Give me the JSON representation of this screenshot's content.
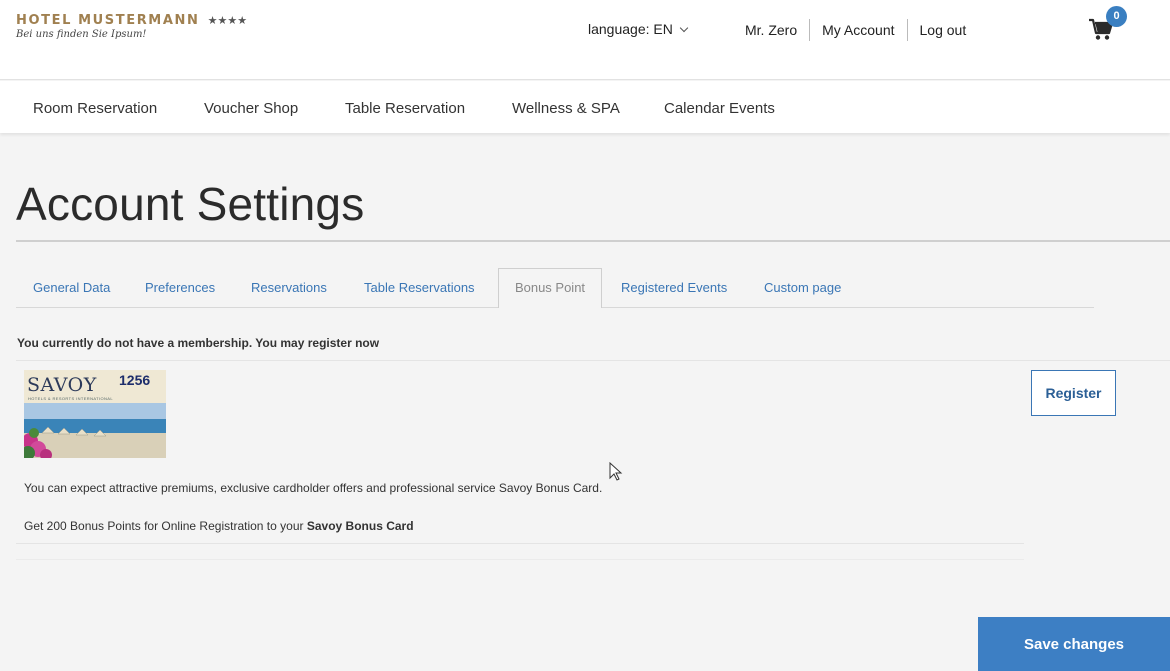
{
  "header": {
    "logo_name": "HOTEL MUSTERMANN",
    "logo_stars": "★★★★",
    "logo_tagline": "Bei uns finden Sie Ipsum!",
    "language": "language: EN",
    "user_name": "Mr. Zero",
    "my_account": "My Account",
    "logout": "Log out",
    "cart_count": "0"
  },
  "nav": {
    "items": [
      "Room Reservation",
      "Voucher Shop",
      "Table Reservation",
      "Wellness & SPA",
      "Calendar Events"
    ]
  },
  "page": {
    "title": "Account Settings"
  },
  "tabs": {
    "items": [
      "General Data",
      "Preferences",
      "Reservations",
      "Table Reservations",
      "Bonus Point",
      "Registered Events",
      "Custom page"
    ],
    "active": "Bonus Point"
  },
  "bonus": {
    "notice": "You currently do not have a membership. You may register now",
    "card_brand": "SAVOY",
    "card_subtitle": "HOTELS & RESORTS INTERNATIONAL",
    "card_number": "1256",
    "register_label": "Register",
    "description": "You can expect attractive premiums, exclusive cardholder offers and professional service Savoy Bonus Card.",
    "reward_text": "Get 200 Bonus Points for Online Registration to your",
    "reward_card": "Savoy Bonus Card"
  },
  "footer": {
    "save_label": "Save changes"
  },
  "colors": {
    "accent": "#3d7fc4",
    "link": "#3a76b5",
    "brand_gold": "#a08050"
  }
}
